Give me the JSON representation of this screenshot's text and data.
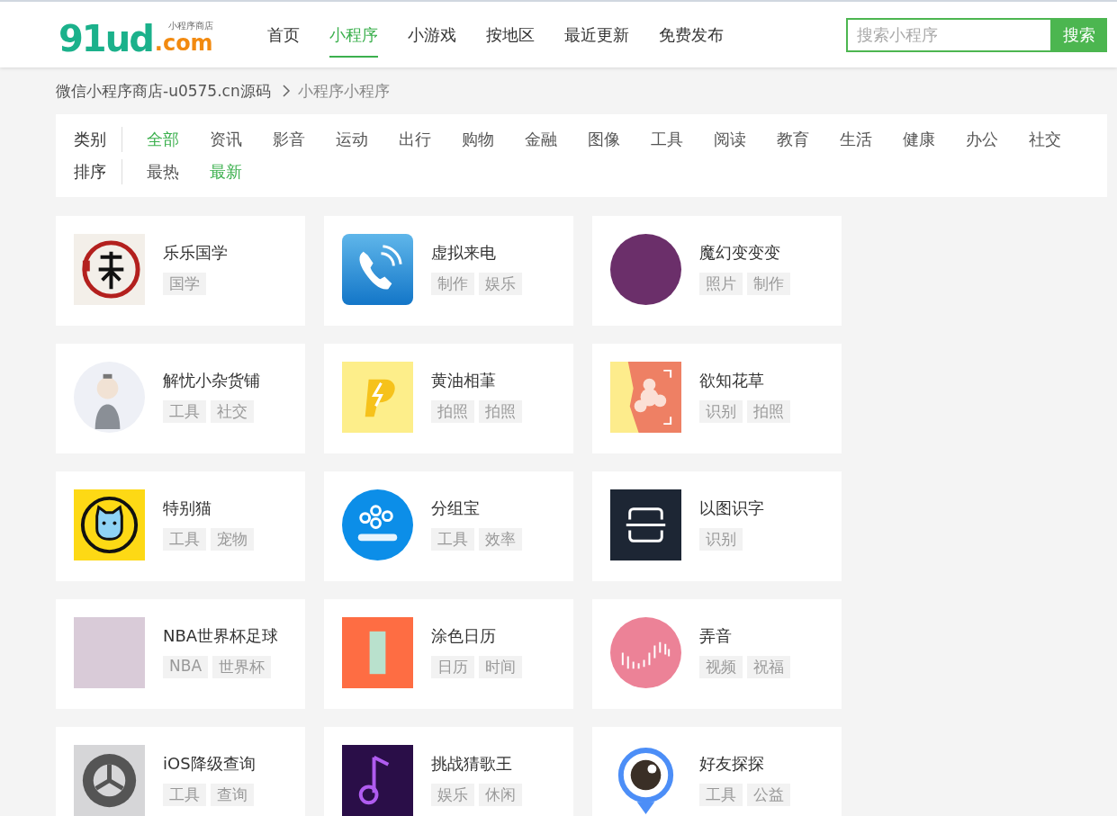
{
  "logo": {
    "main": "91ud",
    "suffix": ".com",
    "tagline": "小程序商店"
  },
  "nav": [
    {
      "label": "首页",
      "selected": false
    },
    {
      "label": "小程序",
      "selected": true
    },
    {
      "label": "小游戏",
      "selected": false
    },
    {
      "label": "按地区",
      "selected": false
    },
    {
      "label": "最近更新",
      "selected": false
    },
    {
      "label": "免费发布",
      "selected": false
    }
  ],
  "search": {
    "placeholder": "搜索小程序",
    "button": "搜索"
  },
  "breadcrumb": [
    "微信小程序商店-u0575.cn源码",
    "小程序小程序"
  ],
  "filters": [
    {
      "label": "类别",
      "options": [
        {
          "label": "全部",
          "selected": true
        },
        {
          "label": "资讯",
          "selected": false
        },
        {
          "label": "影音",
          "selected": false
        },
        {
          "label": "运动",
          "selected": false
        },
        {
          "label": "出行",
          "selected": false
        },
        {
          "label": "购物",
          "selected": false
        },
        {
          "label": "金融",
          "selected": false
        },
        {
          "label": "图像",
          "selected": false
        },
        {
          "label": "工具",
          "selected": false
        },
        {
          "label": "阅读",
          "selected": false
        },
        {
          "label": "教育",
          "selected": false
        },
        {
          "label": "生活",
          "selected": false
        },
        {
          "label": "健康",
          "selected": false
        },
        {
          "label": "办公",
          "selected": false
        },
        {
          "label": "社交",
          "selected": false
        }
      ]
    },
    {
      "label": "排序",
      "options": [
        {
          "label": "最热",
          "selected": false
        },
        {
          "label": "最新",
          "selected": true
        }
      ]
    }
  ],
  "apps": [
    {
      "name": "乐乐国学",
      "tags": [
        "国学"
      ]
    },
    {
      "name": "虚拟来电",
      "tags": [
        "制作",
        "娱乐"
      ]
    },
    {
      "name": "魔幻变变变",
      "tags": [
        "照片",
        "制作"
      ]
    },
    {
      "name": "解忧小杂货铺",
      "tags": [
        "工具",
        "社交"
      ]
    },
    {
      "name": "黄油相茟",
      "tags": [
        "拍照",
        "拍照"
      ]
    },
    {
      "name": "欲知花草",
      "tags": [
        "识别",
        "拍照"
      ]
    },
    {
      "name": "特别猫",
      "tags": [
        "工具",
        "宠物"
      ]
    },
    {
      "name": "分组宝",
      "tags": [
        "工具",
        "效率"
      ]
    },
    {
      "name": "以图识字",
      "tags": [
        "识别"
      ]
    },
    {
      "name": "NBA世界杯足球",
      "tags": [
        "NBA",
        "世界杯"
      ]
    },
    {
      "name": "涂色日历",
      "tags": [
        "日历",
        "时间"
      ]
    },
    {
      "name": "弄音",
      "tags": [
        "视频",
        "祝福"
      ]
    },
    {
      "name": "iOS降级查询",
      "tags": [
        "工具",
        "查询"
      ]
    },
    {
      "name": "挑战猜歌王",
      "tags": [
        "娱乐",
        "休闲"
      ]
    },
    {
      "name": "好友探探",
      "tags": [
        "工具",
        "公益"
      ]
    }
  ]
}
